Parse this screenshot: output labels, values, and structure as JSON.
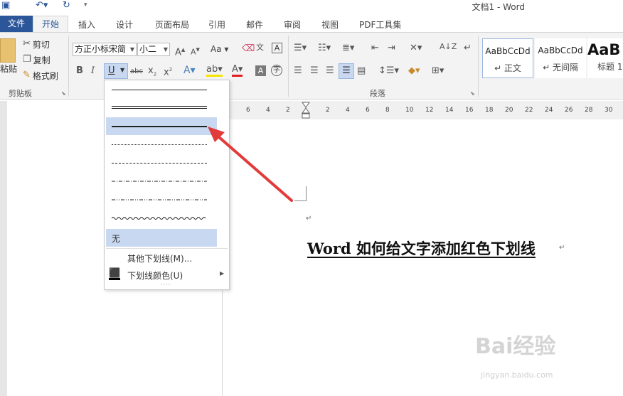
{
  "window": {
    "title": "文档1 - Word"
  },
  "quick_access": {
    "save_icon": "save-icon",
    "undo_icon": "undo-icon",
    "redo_icon": "redo-icon"
  },
  "tabs": [
    {
      "label": "文件"
    },
    {
      "label": "开始"
    },
    {
      "label": "插入"
    },
    {
      "label": "设计"
    },
    {
      "label": "页面布局"
    },
    {
      "label": "引用"
    },
    {
      "label": "邮件"
    },
    {
      "label": "审阅"
    },
    {
      "label": "视图"
    },
    {
      "label": "PDF工具集"
    }
  ],
  "clipboard": {
    "paste": "粘贴",
    "cut": "剪切",
    "copy": "复制",
    "format_painter": "格式刷",
    "group_label": "剪贴板"
  },
  "font": {
    "name": "方正小标宋简",
    "size": "小二",
    "case_label": "Aa"
  },
  "paragraph": {
    "group_label": "段落"
  },
  "styles": [
    {
      "sample": "AaBbCcDd",
      "name": "↵ 正文"
    },
    {
      "sample": "AaBbCcDd",
      "name": "↵ 无间隔"
    },
    {
      "sample": "AaB",
      "name": "标题 1"
    }
  ],
  "ruler": {
    "ticks": [
      "6",
      "4",
      "2",
      "2",
      "4",
      "6",
      "8",
      "10",
      "12",
      "14",
      "16",
      "18",
      "20",
      "22",
      "24",
      "26",
      "28",
      "30"
    ]
  },
  "document": {
    "heading": "Word 如何给文字添加红色下划线"
  },
  "underline_menu": {
    "none_label": "无",
    "more_label": "其他下划线(M)...",
    "color_label": "下划线颜色(U)"
  },
  "colors": {
    "accent": "#2b579a",
    "highlight": "#c7d8f0",
    "arrow": "#e23b3b"
  },
  "watermark": {
    "brand": "Bai经验",
    "url": "jingyan.baidu.com"
  }
}
